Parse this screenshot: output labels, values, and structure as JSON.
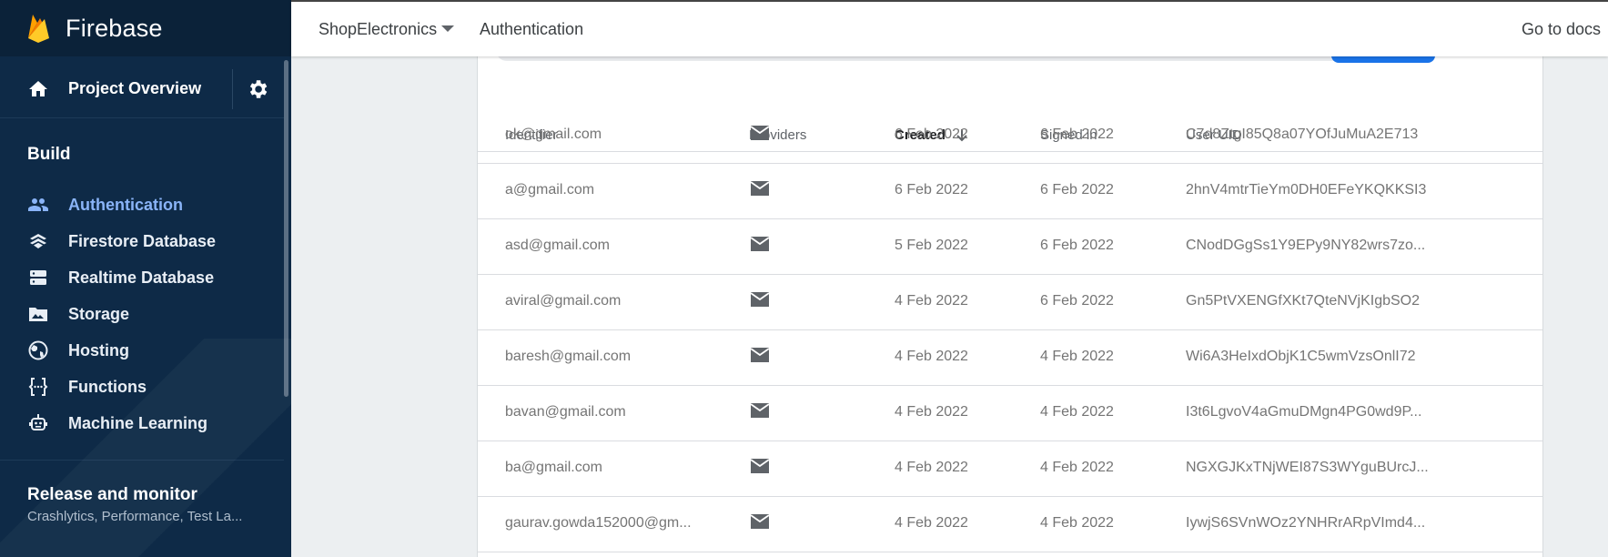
{
  "brand": {
    "name": "Firebase"
  },
  "sidebar": {
    "project_overview": "Project Overview",
    "build_title": "Build",
    "items": [
      {
        "label": "Authentication",
        "icon": "people-icon",
        "active": true
      },
      {
        "label": "Firestore Database",
        "icon": "firestore-icon",
        "active": false
      },
      {
        "label": "Realtime Database",
        "icon": "database-icon",
        "active": false
      },
      {
        "label": "Storage",
        "icon": "photo-folder-icon",
        "active": false
      },
      {
        "label": "Hosting",
        "icon": "globe-icon",
        "active": false
      },
      {
        "label": "Functions",
        "icon": "functions-icon",
        "active": false
      },
      {
        "label": "Machine Learning",
        "icon": "robot-icon",
        "active": false
      }
    ],
    "release_title": "Release and monitor",
    "release_subtitle": "Crashlytics, Performance, Test La..."
  },
  "topbar": {
    "project": "ShopElectronics",
    "breadcrumb": "Authentication",
    "docs_link": "Go to docs"
  },
  "table": {
    "headers": {
      "identifier": "Identifier",
      "providers": "Providers",
      "created": "Created",
      "signed_in": "Signed in",
      "uid": "User UID"
    },
    "rows": [
      {
        "identifier": "ok@gmail.com",
        "created": "6 Feb 2022",
        "signed_in": "6 Feb 2022",
        "uid": "C7d8ZtgI85Q8a07YOfJuMuA2E713"
      },
      {
        "identifier": "a@gmail.com",
        "created": "6 Feb 2022",
        "signed_in": "6 Feb 2022",
        "uid": "2hnV4mtrTieYm0DH0EFeYKQKKSI3"
      },
      {
        "identifier": "asd@gmail.com",
        "created": "5 Feb 2022",
        "signed_in": "6 Feb 2022",
        "uid": "CNodDGgSs1Y9EPy9NY82wrs7zo..."
      },
      {
        "identifier": "aviral@gmail.com",
        "created": "4 Feb 2022",
        "signed_in": "6 Feb 2022",
        "uid": "Gn5PtVXENGfXKt7QteNVjKIgbSO2"
      },
      {
        "identifier": "baresh@gmail.com",
        "created": "4 Feb 2022",
        "signed_in": "4 Feb 2022",
        "uid": "Wi6A3HeIxdObjK1C5wmVzsOnlI72"
      },
      {
        "identifier": "bavan@gmail.com",
        "created": "4 Feb 2022",
        "signed_in": "4 Feb 2022",
        "uid": "I3t6LgvoV4aGmuDMgn4PG0wd9P..."
      },
      {
        "identifier": "ba@gmail.com",
        "created": "4 Feb 2022",
        "signed_in": "4 Feb 2022",
        "uid": "NGXGJKxTNjWEI87S3WYguBUrcJ..."
      },
      {
        "identifier": "gaurav.gowda152000@gm...",
        "created": "4 Feb 2022",
        "signed_in": "4 Feb 2022",
        "uid": "IywjS6SVnWOz2YNHRrARpVImd4..."
      }
    ]
  },
  "colors": {
    "sidebar_bg": "#0e2a47",
    "active_item": "#8ab4f8",
    "accent_blue": "#1a73e8"
  }
}
